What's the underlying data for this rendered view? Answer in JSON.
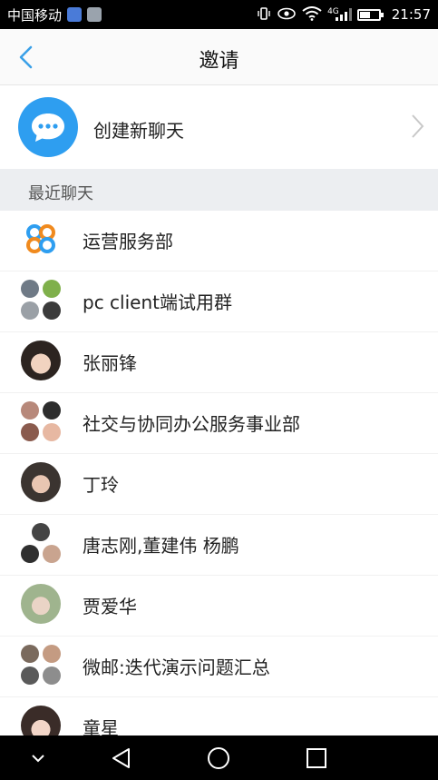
{
  "status_bar": {
    "carrier": "中国移动",
    "network": "4G",
    "time": "21:57",
    "icons": [
      "app-notification-icon",
      "image-notification-icon",
      "vibrate-icon",
      "eye-icon",
      "wifi-icon",
      "signal-icon",
      "battery-icon"
    ]
  },
  "header": {
    "title": "邀请",
    "back_icon": "chevron-left-icon"
  },
  "create_chat": {
    "label": "创建新聊天",
    "icon": "chat-bubble-icon"
  },
  "recent": {
    "section_label": "最近聊天",
    "items": [
      {
        "label": "运营服务部"
      },
      {
        "label": "pc client端试用群"
      },
      {
        "label": "张丽锋"
      },
      {
        "label": "社交与协同办公服务事业部"
      },
      {
        "label": "丁玲"
      },
      {
        "label": "唐志刚,董建伟  杨鹏"
      },
      {
        "label": "贾爱华"
      },
      {
        "label": "微邮:迭代演示问题汇总"
      },
      {
        "label": "童星"
      }
    ]
  },
  "navigation": {
    "buttons": [
      "chevron-down-icon",
      "back-triangle-icon",
      "home-circle-icon",
      "recents-square-icon"
    ]
  },
  "colors": {
    "accent": "#2e9ef0",
    "section_bg": "#eceef1"
  }
}
